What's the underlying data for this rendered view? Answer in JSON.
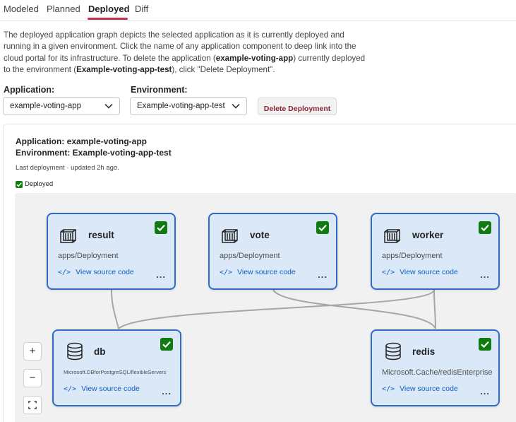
{
  "tabs": [
    {
      "label": "Modeled",
      "active": false
    },
    {
      "label": "Planned",
      "active": false
    },
    {
      "label": "Deployed",
      "active": true
    },
    {
      "label": "Diff",
      "active": false
    }
  ],
  "description": {
    "part1": "The deployed application graph depicts the selected application as it is currently deployed and running in a given environment. Click the name of any application component to deep link into the cloud portal for its infrastructure. To delete the application (",
    "app": "example-voting-app",
    "part2": ") currently deployed to the environment (",
    "env": "Example-voting-app-test",
    "part3": "), click \"Delete Deployment\"."
  },
  "controls": {
    "application_label": "Application:",
    "application_value": "example-voting-app",
    "environment_label": "Environment:",
    "environment_value": "Example-voting-app-test",
    "delete_button": "Delete Deployment"
  },
  "panel": {
    "app_title": "Application: example-voting-app",
    "env_title": "Environment: Example-voting-app-test",
    "last_deployment": "Last deployment · updated 2h ago.",
    "deployed_label": "Deployed"
  },
  "graph": {
    "nodes": [
      {
        "name": "result",
        "type": "apps/Deployment",
        "link": "View source code",
        "icon": "container-icon"
      },
      {
        "name": "vote",
        "type": "apps/Deployment",
        "link": "View source code",
        "icon": "container-icon"
      },
      {
        "name": "worker",
        "type": "apps/Deployment",
        "link": "View source code",
        "icon": "container-icon"
      },
      {
        "name": "db",
        "type": "Microsoft.DBforPostgreSQL/flexibleServers",
        "link": "View source code",
        "icon": "database-icon"
      },
      {
        "name": "redis",
        "type": "Microsoft.Cache/redisEnterprise",
        "link": "View source code",
        "icon": "database-icon"
      }
    ],
    "code_glyph": "</>",
    "more_glyph": "...",
    "edges": [
      [
        "result",
        "db"
      ],
      [
        "vote",
        "redis"
      ],
      [
        "worker",
        "db"
      ],
      [
        "worker",
        "redis"
      ]
    ]
  },
  "zoom": {
    "in": "+",
    "out": "−"
  },
  "colors": {
    "accent": "#c4314b",
    "card_border": "#2f6cc4",
    "card_fill": "#dbe8f7",
    "check": "#107c10",
    "link": "#0f5fbf"
  }
}
